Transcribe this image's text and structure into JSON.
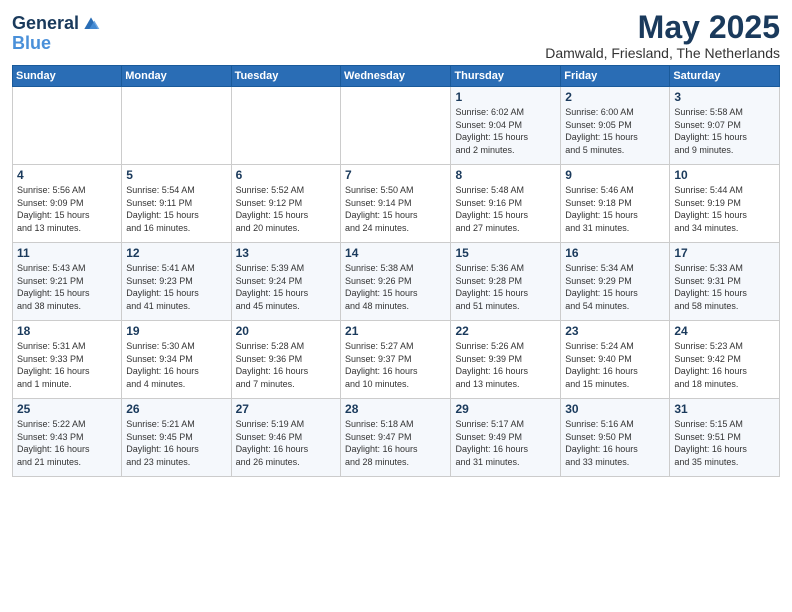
{
  "logo": {
    "line1": "General",
    "line2": "Blue"
  },
  "title": "May 2025",
  "subtitle": "Damwald, Friesland, The Netherlands",
  "headers": [
    "Sunday",
    "Monday",
    "Tuesday",
    "Wednesday",
    "Thursday",
    "Friday",
    "Saturday"
  ],
  "weeks": [
    [
      {
        "day": "",
        "info": ""
      },
      {
        "day": "",
        "info": ""
      },
      {
        "day": "",
        "info": ""
      },
      {
        "day": "",
        "info": ""
      },
      {
        "day": "1",
        "info": "Sunrise: 6:02 AM\nSunset: 9:04 PM\nDaylight: 15 hours\nand 2 minutes."
      },
      {
        "day": "2",
        "info": "Sunrise: 6:00 AM\nSunset: 9:05 PM\nDaylight: 15 hours\nand 5 minutes."
      },
      {
        "day": "3",
        "info": "Sunrise: 5:58 AM\nSunset: 9:07 PM\nDaylight: 15 hours\nand 9 minutes."
      }
    ],
    [
      {
        "day": "4",
        "info": "Sunrise: 5:56 AM\nSunset: 9:09 PM\nDaylight: 15 hours\nand 13 minutes."
      },
      {
        "day": "5",
        "info": "Sunrise: 5:54 AM\nSunset: 9:11 PM\nDaylight: 15 hours\nand 16 minutes."
      },
      {
        "day": "6",
        "info": "Sunrise: 5:52 AM\nSunset: 9:12 PM\nDaylight: 15 hours\nand 20 minutes."
      },
      {
        "day": "7",
        "info": "Sunrise: 5:50 AM\nSunset: 9:14 PM\nDaylight: 15 hours\nand 24 minutes."
      },
      {
        "day": "8",
        "info": "Sunrise: 5:48 AM\nSunset: 9:16 PM\nDaylight: 15 hours\nand 27 minutes."
      },
      {
        "day": "9",
        "info": "Sunrise: 5:46 AM\nSunset: 9:18 PM\nDaylight: 15 hours\nand 31 minutes."
      },
      {
        "day": "10",
        "info": "Sunrise: 5:44 AM\nSunset: 9:19 PM\nDaylight: 15 hours\nand 34 minutes."
      }
    ],
    [
      {
        "day": "11",
        "info": "Sunrise: 5:43 AM\nSunset: 9:21 PM\nDaylight: 15 hours\nand 38 minutes."
      },
      {
        "day": "12",
        "info": "Sunrise: 5:41 AM\nSunset: 9:23 PM\nDaylight: 15 hours\nand 41 minutes."
      },
      {
        "day": "13",
        "info": "Sunrise: 5:39 AM\nSunset: 9:24 PM\nDaylight: 15 hours\nand 45 minutes."
      },
      {
        "day": "14",
        "info": "Sunrise: 5:38 AM\nSunset: 9:26 PM\nDaylight: 15 hours\nand 48 minutes."
      },
      {
        "day": "15",
        "info": "Sunrise: 5:36 AM\nSunset: 9:28 PM\nDaylight: 15 hours\nand 51 minutes."
      },
      {
        "day": "16",
        "info": "Sunrise: 5:34 AM\nSunset: 9:29 PM\nDaylight: 15 hours\nand 54 minutes."
      },
      {
        "day": "17",
        "info": "Sunrise: 5:33 AM\nSunset: 9:31 PM\nDaylight: 15 hours\nand 58 minutes."
      }
    ],
    [
      {
        "day": "18",
        "info": "Sunrise: 5:31 AM\nSunset: 9:33 PM\nDaylight: 16 hours\nand 1 minute."
      },
      {
        "day": "19",
        "info": "Sunrise: 5:30 AM\nSunset: 9:34 PM\nDaylight: 16 hours\nand 4 minutes."
      },
      {
        "day": "20",
        "info": "Sunrise: 5:28 AM\nSunset: 9:36 PM\nDaylight: 16 hours\nand 7 minutes."
      },
      {
        "day": "21",
        "info": "Sunrise: 5:27 AM\nSunset: 9:37 PM\nDaylight: 16 hours\nand 10 minutes."
      },
      {
        "day": "22",
        "info": "Sunrise: 5:26 AM\nSunset: 9:39 PM\nDaylight: 16 hours\nand 13 minutes."
      },
      {
        "day": "23",
        "info": "Sunrise: 5:24 AM\nSunset: 9:40 PM\nDaylight: 16 hours\nand 15 minutes."
      },
      {
        "day": "24",
        "info": "Sunrise: 5:23 AM\nSunset: 9:42 PM\nDaylight: 16 hours\nand 18 minutes."
      }
    ],
    [
      {
        "day": "25",
        "info": "Sunrise: 5:22 AM\nSunset: 9:43 PM\nDaylight: 16 hours\nand 21 minutes."
      },
      {
        "day": "26",
        "info": "Sunrise: 5:21 AM\nSunset: 9:45 PM\nDaylight: 16 hours\nand 23 minutes."
      },
      {
        "day": "27",
        "info": "Sunrise: 5:19 AM\nSunset: 9:46 PM\nDaylight: 16 hours\nand 26 minutes."
      },
      {
        "day": "28",
        "info": "Sunrise: 5:18 AM\nSunset: 9:47 PM\nDaylight: 16 hours\nand 28 minutes."
      },
      {
        "day": "29",
        "info": "Sunrise: 5:17 AM\nSunset: 9:49 PM\nDaylight: 16 hours\nand 31 minutes."
      },
      {
        "day": "30",
        "info": "Sunrise: 5:16 AM\nSunset: 9:50 PM\nDaylight: 16 hours\nand 33 minutes."
      },
      {
        "day": "31",
        "info": "Sunrise: 5:15 AM\nSunset: 9:51 PM\nDaylight: 16 hours\nand 35 minutes."
      }
    ]
  ]
}
